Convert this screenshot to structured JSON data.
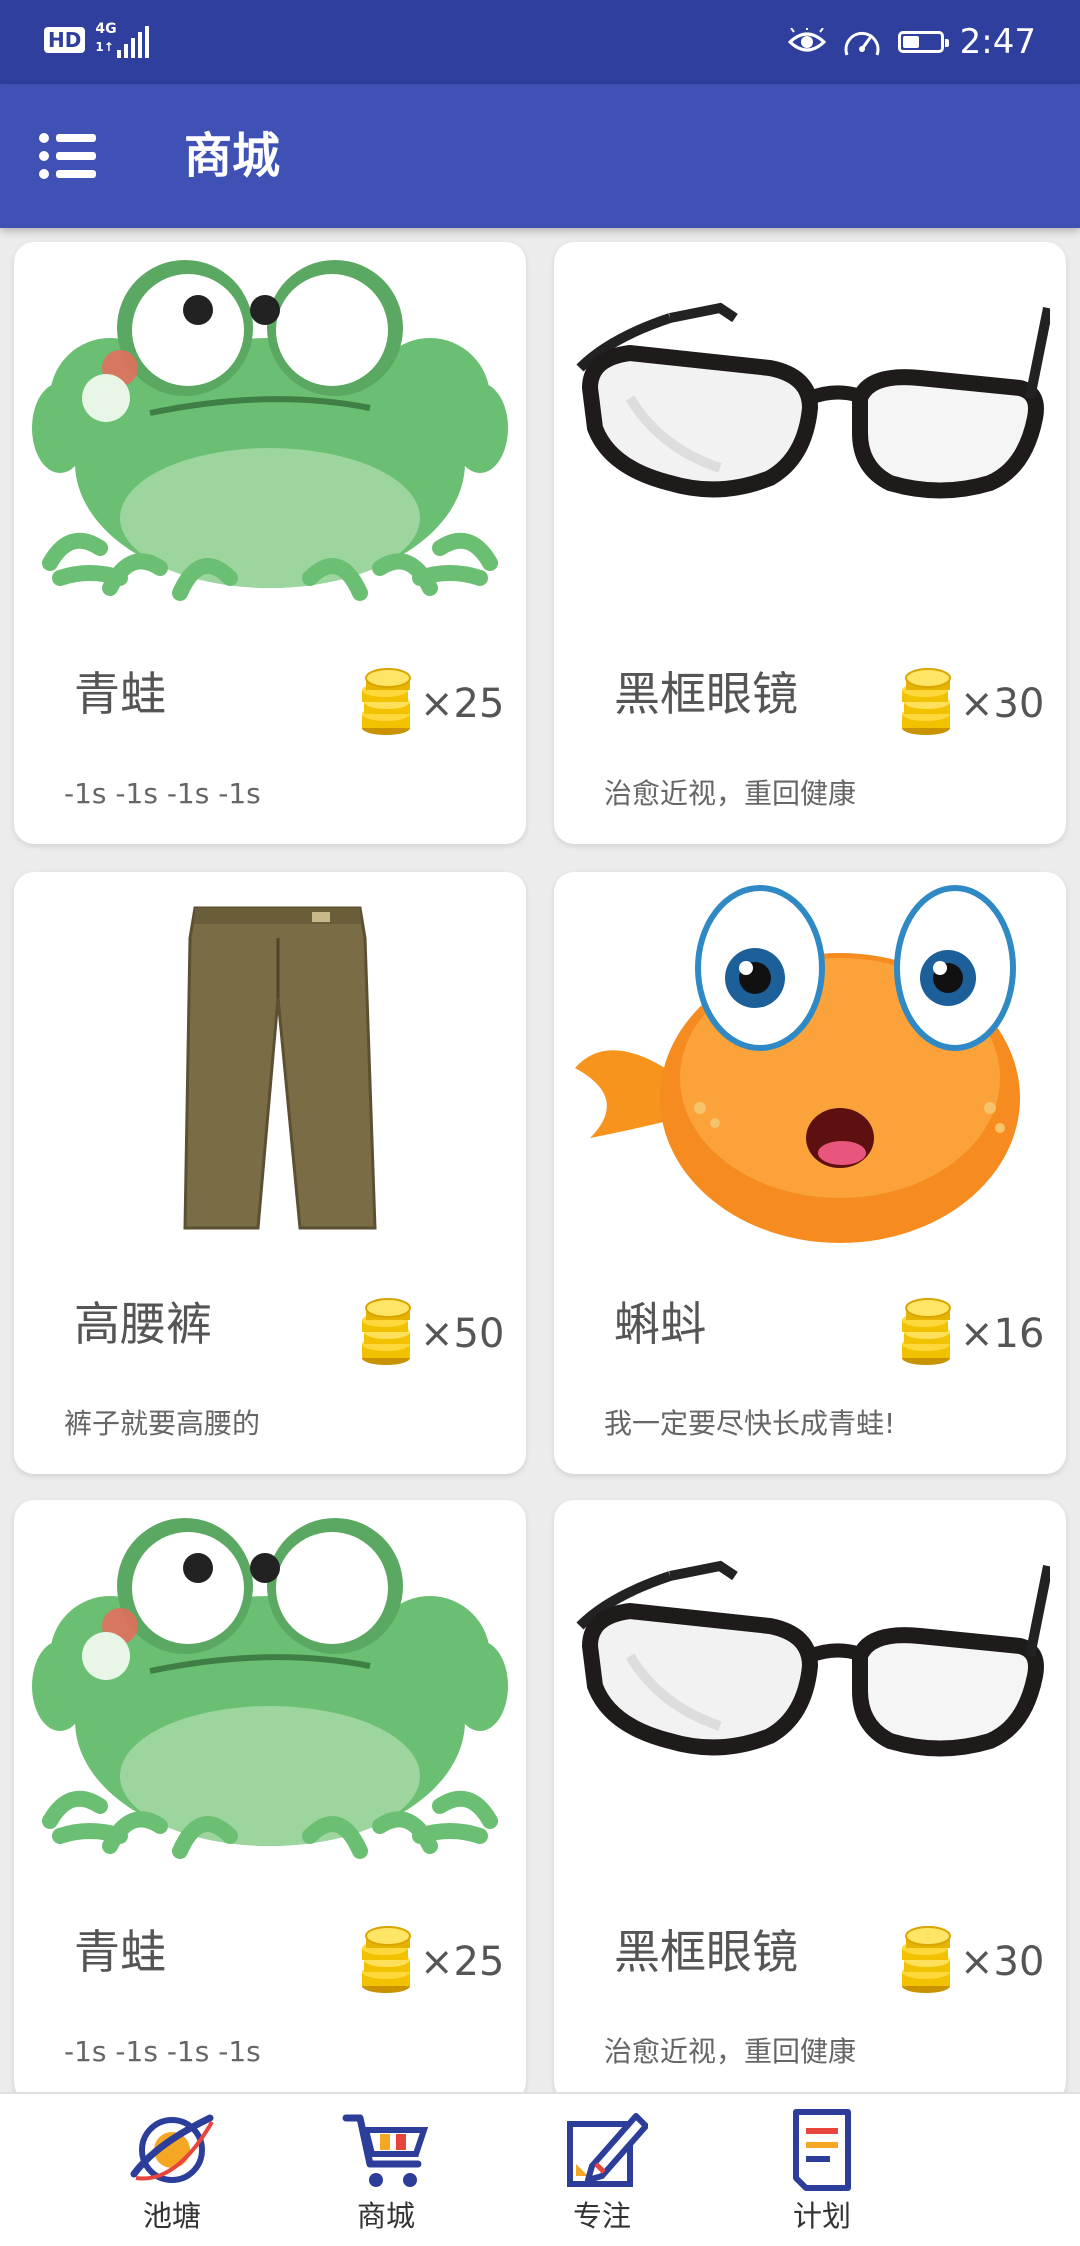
{
  "status_bar": {
    "hd": "HD",
    "network_top": "4G",
    "network_bottom": "1↑",
    "time": "2:47",
    "battery_level": 0.45
  },
  "app_bar": {
    "title": "商城",
    "menu_icon": "menu-icon"
  },
  "products": [
    {
      "name": "青蛙",
      "price": "×25",
      "desc": "-1s -1s -1s -1s",
      "image": "frog-image"
    },
    {
      "name": "黑框眼镜",
      "price": "×30",
      "desc": "治愈近视，重回健康",
      "image": "glasses-image"
    },
    {
      "name": "高腰裤",
      "price": "×50",
      "desc": "裤子就要高腰的",
      "image": "pants-image"
    },
    {
      "name": "蝌蚪",
      "price": "×16",
      "desc": "我一定要尽快长成青蛙!",
      "image": "tadpole-image"
    },
    {
      "name": "青蛙",
      "price": "×25",
      "desc": "-1s -1s -1s -1s",
      "image": "frog-image"
    },
    {
      "name": "黑框眼镜",
      "price": "×30",
      "desc": "治愈近视，重回健康",
      "image": "glasses-image"
    }
  ],
  "bottom_nav": [
    {
      "label": "池塘",
      "icon": "planet-icon"
    },
    {
      "label": "商城",
      "icon": "cart-icon"
    },
    {
      "label": "专注",
      "icon": "edit-icon"
    },
    {
      "label": "计划",
      "icon": "document-icon"
    }
  ],
  "colors": {
    "status_bar": "#2f3f9e",
    "app_bar": "#3f51b5",
    "background": "#ececec",
    "card": "#ffffff"
  }
}
